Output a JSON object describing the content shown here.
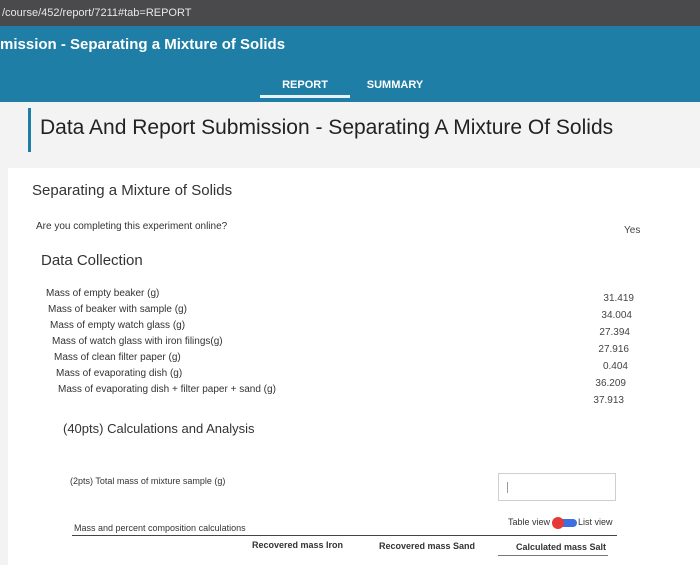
{
  "browser": {
    "url": "/course/452/report/7211#tab=REPORT"
  },
  "header": {
    "app_title": "mission - Separating a Mixture of Solids",
    "tabs": [
      {
        "label": "REPORT",
        "active": true
      },
      {
        "label": "SUMMARY",
        "active": false
      }
    ]
  },
  "page": {
    "title": "Data And Report Submission - Separating A Mixture Of Solids"
  },
  "experiment": {
    "title": "Separating a Mixture of Solids",
    "online_question": "Are you completing this experiment online?",
    "online_answer": "Yes"
  },
  "data_collection": {
    "title": "Data Collection",
    "rows": [
      {
        "label": "Mass of empty beaker (g)",
        "value": "31.419"
      },
      {
        "label": "Mass of beaker with sample (g)",
        "value": "34.004"
      },
      {
        "label": "Mass of empty watch glass (g)",
        "value": "27.394"
      },
      {
        "label": "Mass of watch glass with iron filings(g)",
        "value": "27.916"
      },
      {
        "label": "Mass of clean filter paper (g)",
        "value": "0.404"
      },
      {
        "label": "Mass of evaporating dish (g)",
        "value": "36.209"
      },
      {
        "label": "Mass of evaporating dish + filter paper + sand (g)",
        "value": "37.913"
      }
    ]
  },
  "calculations": {
    "title": "(40pts) Calculations and Analysis",
    "q1_label": "(2pts)  Total mass of mixture sample (g)",
    "q1_value": "",
    "toggle": {
      "left_label": "Table view",
      "right_label": "List view"
    },
    "mass_percent_label": "Mass and percent composition calculations",
    "columns": [
      "Recovered mass Iron",
      "Recovered mass Sand",
      "Calculated mass Salt"
    ]
  },
  "colors": {
    "header_bg": "#1f7ea5",
    "toggle_track": "#3d6fe3",
    "toggle_knob": "#e53935"
  },
  "icons": {
    "cursor": "text-cursor"
  }
}
